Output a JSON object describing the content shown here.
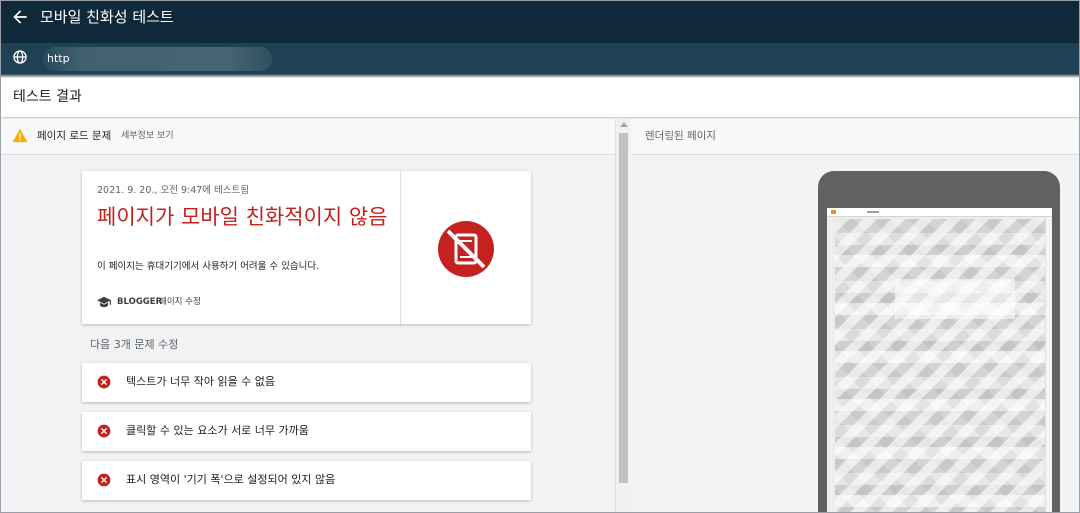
{
  "header": {
    "title": "모바일 친화성 테스트"
  },
  "url_bar": {
    "prefix": "http"
  },
  "section": {
    "title": "테스트 결과"
  },
  "issue_bar": {
    "label": "페이지 로드 문제",
    "link": "세부정보 보기"
  },
  "result": {
    "timestamp": "2021. 9. 20., 오전 9:47에 테스트됨",
    "headline": "페이지가 모바일 친화적이지 않음",
    "description": "이 페이지는 휴대기기에서 사용하기 어려울 수 있습니다.",
    "platform_name": "BLOGGER",
    "platform_link": "페이지 수정"
  },
  "fixes": {
    "heading": "다음 3개 문제 수정",
    "items": [
      {
        "label": "텍스트가 너무 작아 읽을 수 없음"
      },
      {
        "label": "클릭할 수 있는 요소가 서로 너무 가까움"
      },
      {
        "label": "표시 영역이 '기기 폭'으로 설정되어 있지 않음"
      }
    ]
  },
  "preview": {
    "title": "렌더링된 페이지"
  },
  "colors": {
    "header": "#10293a",
    "url_bar": "#1e4254",
    "error": "#c5221f",
    "warning": "#f9ab00"
  },
  "icons": {
    "back": "arrow-back-icon",
    "globe": "globe-icon",
    "warning": "warning-icon",
    "platform": "graduation-cap-icon",
    "status": "not-mobile-friendly-icon",
    "error": "error-circle-icon"
  }
}
